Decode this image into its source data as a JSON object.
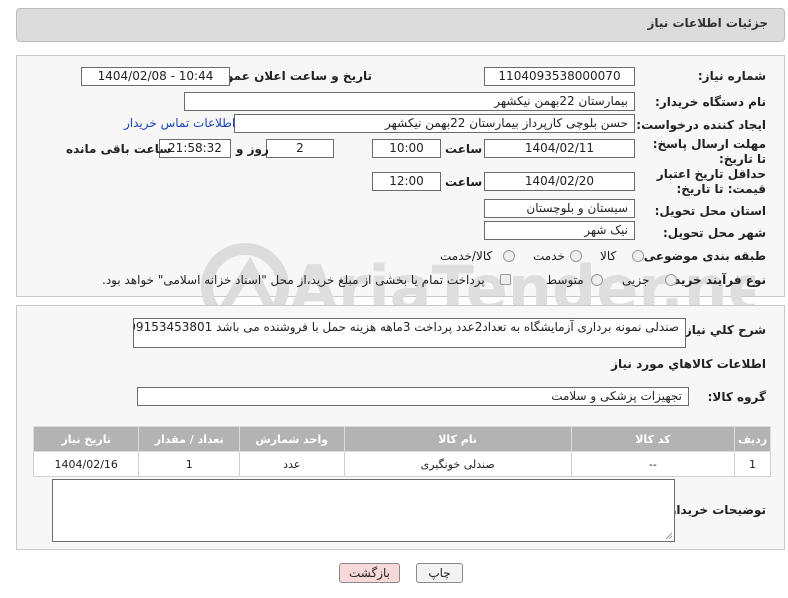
{
  "header": {
    "title": "جزئیات اطلاعات نیاز"
  },
  "fields": {
    "need_number_label": "شماره نیاز:",
    "need_number": "1104093538000070",
    "announce_label": "تاریخ و ساعت اعلان عمومی:",
    "announce_value": "1404/02/08 - 10:44",
    "buyer_org_label": "نام دستگاه خریدار:",
    "buyer_org": "بیمارستان 22بهمن نیکشهر",
    "creator_label": "ایجاد کننده درخواست:",
    "creator": "حسن بلوچی کارپرداز  بیمارستان 22بهمن نیکشهر",
    "contact_link": "اطلاعات تماس خریدار",
    "deadline_label": "مهلت ارسال پاسخ: تا تاریخ:",
    "deadline_date": "1404/02/11",
    "time_label": "ساعت",
    "deadline_time": "10:00",
    "days_value": "2",
    "days_label": "روز و",
    "remaining_time": "21:58:32",
    "remaining_label": "ساعت باقی مانده",
    "price_validity_label": "حداقل تاریخ اعتبار قیمت: تا تاریخ:",
    "price_date": "1404/02/20",
    "price_time": "12:00",
    "province_label": "استان محل تحویل:",
    "province": "سیستان و بلوچستان",
    "city_label": "شهر محل تحویل:",
    "city": "نیک شهر",
    "category_label": "طبقه بندی موضوعی:",
    "category_options": [
      "کالا",
      "خدمت",
      "کالا/خدمت"
    ],
    "process_label": "نوع فرآیند خرید :",
    "process_options": [
      "جزیی",
      "متوسط"
    ],
    "payment_note": "پرداخت تمام یا بخشی از مبلغ خرید،از محل \"اسناد خزانه اسلامی\" خواهد بود."
  },
  "details": {
    "description_label": "شرح کلي نياز:",
    "description": "صندلی نمونه برداری آزمایشگاه به تعداد2عدد پرداخت 3ماهه هزینه حمل با فروشنده می باشد 09153453801",
    "goods_info_title": "اطلاعات کالاهاي مورد نياز",
    "goods_group_label": "گروه کالا:",
    "goods_group": "تجهیزات پزشکی و سلامت",
    "buyer_notes_label": "توضیحات خریدار:"
  },
  "table": {
    "headers": [
      "ردیف",
      "کد کالا",
      "نام کالا",
      "واحد شمارش",
      "تعداد / مقدار",
      "تاریخ نیاز"
    ],
    "rows": [
      [
        "1",
        "--",
        "صندلی خونگیری",
        "عدد",
        "1",
        "1404/02/16"
      ]
    ]
  },
  "buttons": {
    "print": "چاپ",
    "back": "بازگشت"
  },
  "watermark": {
    "text": "AriaTender.net"
  },
  "colors": {
    "link": "#1a44b8",
    "back_button_bg": "#f7d9d9",
    "watermark": "#d7d7d7"
  }
}
